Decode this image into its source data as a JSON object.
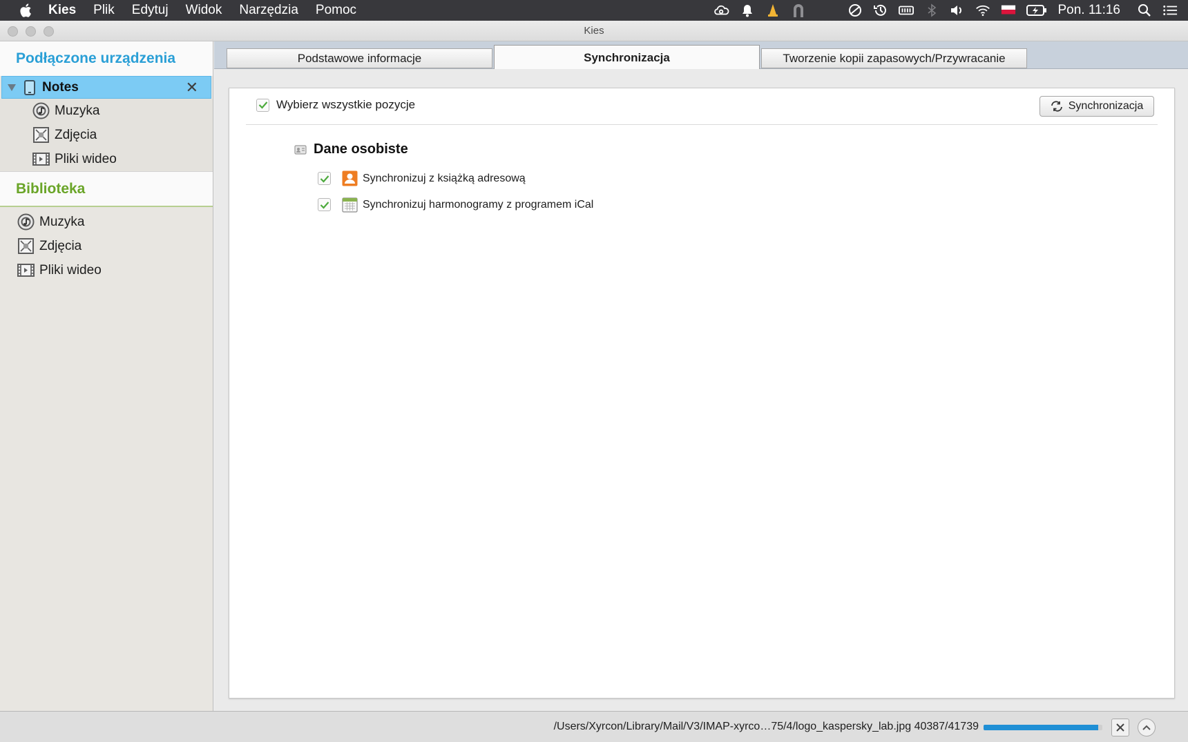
{
  "menubar": {
    "app_name": "Kies",
    "items": [
      "Plik",
      "Edytuj",
      "Widok",
      "Narzędzia",
      "Pomoc"
    ],
    "clock": "Pon. 11:16"
  },
  "window": {
    "title": "Kies"
  },
  "sidebar": {
    "devices_heading": "Podłączone urządzenia",
    "device": {
      "name": "Notes",
      "items": [
        {
          "label": "Muzyka",
          "icon": "music-icon"
        },
        {
          "label": "Zdjęcia",
          "icon": "photo-icon"
        },
        {
          "label": "Pliki wideo",
          "icon": "video-icon"
        }
      ]
    },
    "library_heading": "Biblioteka",
    "library_items": [
      {
        "label": "Muzyka",
        "icon": "music-icon"
      },
      {
        "label": "Zdjęcia",
        "icon": "photo-icon"
      },
      {
        "label": "Pliki wideo",
        "icon": "video-icon"
      }
    ]
  },
  "tabs": [
    {
      "label": "Podstawowe informacje",
      "active": false
    },
    {
      "label": "Synchronizacja",
      "active": true
    },
    {
      "label": "Tworzenie kopii zapasowych/Przywracanie",
      "active": false
    }
  ],
  "sync_panel": {
    "select_all_label": "Wybierz wszystkie pozycje",
    "select_all_checked": true,
    "sync_button_label": "Synchronizacja",
    "group_title": "Dane osobiste",
    "options": [
      {
        "label": "Synchronizuj z książką adresową",
        "checked": true,
        "icon": "contacts-icon"
      },
      {
        "label": "Synchronizuj harmonogramy z programem iCal",
        "checked": true,
        "icon": "calendar-icon"
      }
    ]
  },
  "statusbar": {
    "text": "/Users/Xyrcon/Library/Mail/V3/IMAP-xyrco…75/4/logo_kaspersky_lab.jpg 40387/41739",
    "progress": 0.967
  },
  "colors": {
    "menubar_bg": "#38383c",
    "devices_heading": "#2a9fd6",
    "library_heading": "#6aa528",
    "selected_row": "#7ccbf4",
    "checkmark": "#4caa3c",
    "progress_fill": "#1f8fd5"
  }
}
